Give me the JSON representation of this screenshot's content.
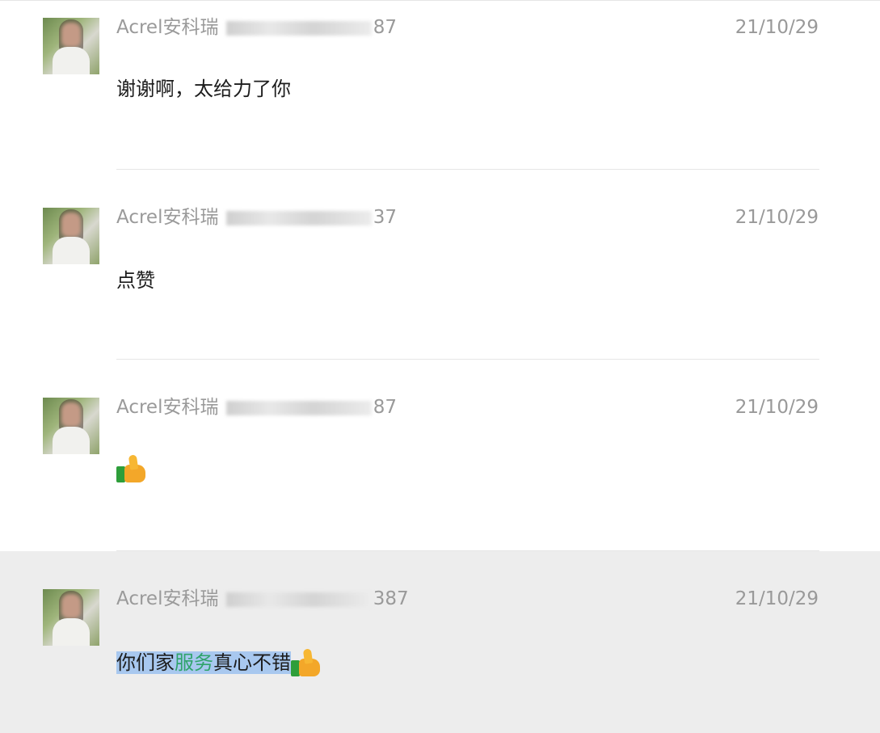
{
  "messages": [
    {
      "author_prefix": "Acrel安科瑞",
      "author_suffix": "87",
      "date": "21/10/29",
      "text": "谢谢啊，太给力了你"
    },
    {
      "author_prefix": "Acrel安科瑞",
      "author_suffix": "37",
      "date": "21/10/29",
      "text": "点赞"
    },
    {
      "author_prefix": "Acrel安科瑞",
      "author_suffix": "87",
      "date": "21/10/29",
      "emoji": "thumbs-up"
    },
    {
      "author_prefix": "Acrel安科瑞",
      "author_suffix": "387",
      "date": "21/10/29",
      "text_part1": "你们家",
      "text_part2": "服务",
      "text_part3": "真心不错",
      "emoji": "thumbs-up",
      "highlighted": true
    }
  ],
  "colors": {
    "highlight_bg": "#ededed",
    "selection": "#a8c8ef",
    "link_green": "#2fa36b"
  }
}
